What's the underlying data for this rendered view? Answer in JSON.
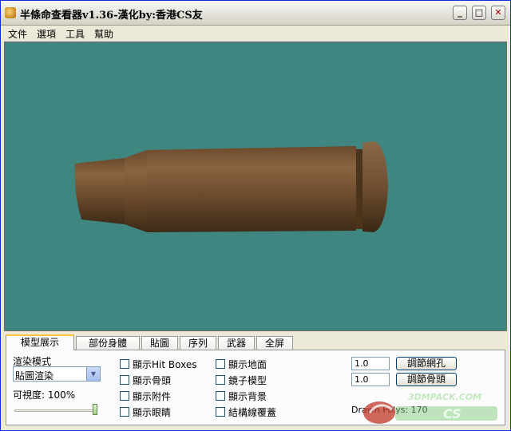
{
  "window": {
    "title": "半條命查看器v1.36-漢化by:香港CS友"
  },
  "menu": [
    "文件",
    "選項",
    "工具",
    "幫助"
  ],
  "tabs": [
    "模型展示",
    "部份身體",
    "貼圖",
    "序列",
    "武器",
    "全屏"
  ],
  "panel": {
    "render_mode_label": "渲染模式",
    "render_mode_value": "貼圖渲染",
    "visibility_label": "可視度: 100%",
    "visibility_level": 1.0,
    "checkboxes_col1": [
      "顯示Hit Boxes",
      "顯示骨頭",
      "顯示附件",
      "顯示眼睛"
    ],
    "checkboxes_col2": [
      "顯示地面",
      "鏡子模型",
      "顯示背景",
      "結構線覆蓋"
    ],
    "value1": "1.0",
    "value2": "1.0",
    "btn1": "調節網孔",
    "btn2": "調節骨頭",
    "drawn_polys": "Drawn Polys: 170"
  },
  "watermark": "3DMPACK.COM",
  "colors": {
    "viewport_bg": "#3f8680",
    "shell": "#7a5230"
  }
}
